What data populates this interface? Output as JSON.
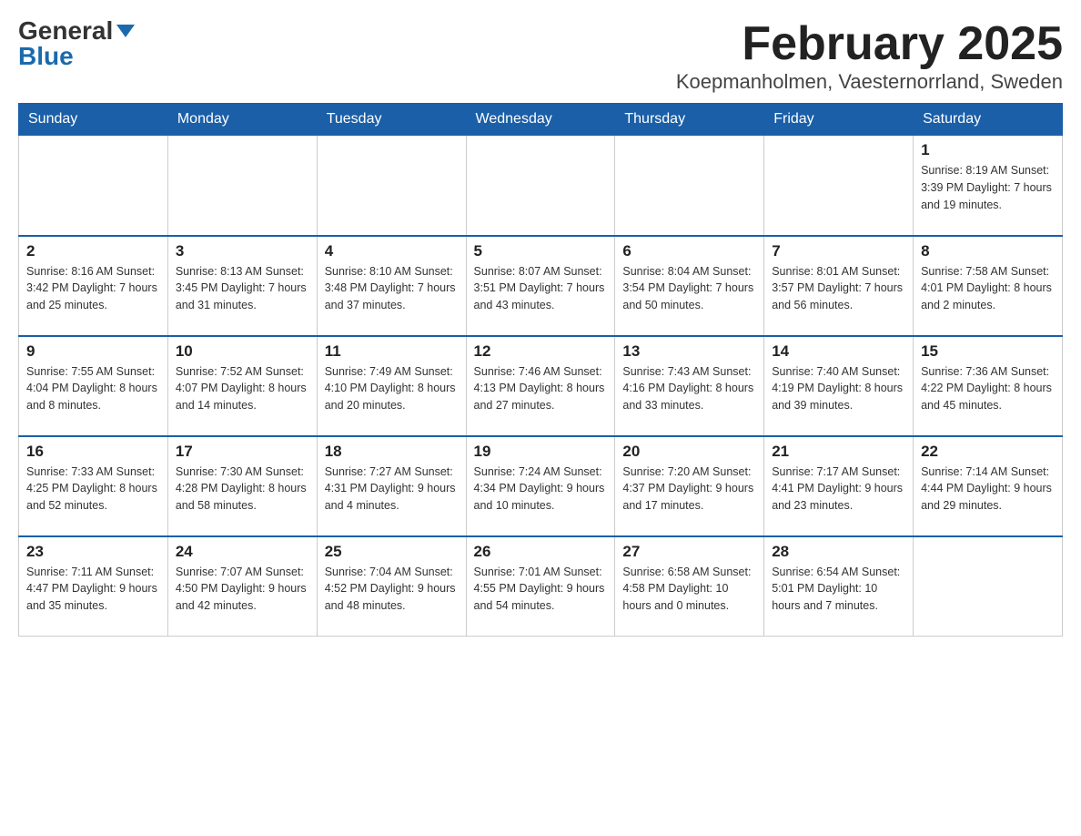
{
  "header": {
    "logo_general": "General",
    "logo_blue": "Blue",
    "month_year": "February 2025",
    "location": "Koepmanholmen, Vaesternorrland, Sweden"
  },
  "days_of_week": [
    "Sunday",
    "Monday",
    "Tuesday",
    "Wednesday",
    "Thursday",
    "Friday",
    "Saturday"
  ],
  "weeks": [
    {
      "days": [
        {
          "number": "",
          "info": ""
        },
        {
          "number": "",
          "info": ""
        },
        {
          "number": "",
          "info": ""
        },
        {
          "number": "",
          "info": ""
        },
        {
          "number": "",
          "info": ""
        },
        {
          "number": "",
          "info": ""
        },
        {
          "number": "1",
          "info": "Sunrise: 8:19 AM\nSunset: 3:39 PM\nDaylight: 7 hours and 19 minutes."
        }
      ]
    },
    {
      "days": [
        {
          "number": "2",
          "info": "Sunrise: 8:16 AM\nSunset: 3:42 PM\nDaylight: 7 hours and 25 minutes."
        },
        {
          "number": "3",
          "info": "Sunrise: 8:13 AM\nSunset: 3:45 PM\nDaylight: 7 hours and 31 minutes."
        },
        {
          "number": "4",
          "info": "Sunrise: 8:10 AM\nSunset: 3:48 PM\nDaylight: 7 hours and 37 minutes."
        },
        {
          "number": "5",
          "info": "Sunrise: 8:07 AM\nSunset: 3:51 PM\nDaylight: 7 hours and 43 minutes."
        },
        {
          "number": "6",
          "info": "Sunrise: 8:04 AM\nSunset: 3:54 PM\nDaylight: 7 hours and 50 minutes."
        },
        {
          "number": "7",
          "info": "Sunrise: 8:01 AM\nSunset: 3:57 PM\nDaylight: 7 hours and 56 minutes."
        },
        {
          "number": "8",
          "info": "Sunrise: 7:58 AM\nSunset: 4:01 PM\nDaylight: 8 hours and 2 minutes."
        }
      ]
    },
    {
      "days": [
        {
          "number": "9",
          "info": "Sunrise: 7:55 AM\nSunset: 4:04 PM\nDaylight: 8 hours and 8 minutes."
        },
        {
          "number": "10",
          "info": "Sunrise: 7:52 AM\nSunset: 4:07 PM\nDaylight: 8 hours and 14 minutes."
        },
        {
          "number": "11",
          "info": "Sunrise: 7:49 AM\nSunset: 4:10 PM\nDaylight: 8 hours and 20 minutes."
        },
        {
          "number": "12",
          "info": "Sunrise: 7:46 AM\nSunset: 4:13 PM\nDaylight: 8 hours and 27 minutes."
        },
        {
          "number": "13",
          "info": "Sunrise: 7:43 AM\nSunset: 4:16 PM\nDaylight: 8 hours and 33 minutes."
        },
        {
          "number": "14",
          "info": "Sunrise: 7:40 AM\nSunset: 4:19 PM\nDaylight: 8 hours and 39 minutes."
        },
        {
          "number": "15",
          "info": "Sunrise: 7:36 AM\nSunset: 4:22 PM\nDaylight: 8 hours and 45 minutes."
        }
      ]
    },
    {
      "days": [
        {
          "number": "16",
          "info": "Sunrise: 7:33 AM\nSunset: 4:25 PM\nDaylight: 8 hours and 52 minutes."
        },
        {
          "number": "17",
          "info": "Sunrise: 7:30 AM\nSunset: 4:28 PM\nDaylight: 8 hours and 58 minutes."
        },
        {
          "number": "18",
          "info": "Sunrise: 7:27 AM\nSunset: 4:31 PM\nDaylight: 9 hours and 4 minutes."
        },
        {
          "number": "19",
          "info": "Sunrise: 7:24 AM\nSunset: 4:34 PM\nDaylight: 9 hours and 10 minutes."
        },
        {
          "number": "20",
          "info": "Sunrise: 7:20 AM\nSunset: 4:37 PM\nDaylight: 9 hours and 17 minutes."
        },
        {
          "number": "21",
          "info": "Sunrise: 7:17 AM\nSunset: 4:41 PM\nDaylight: 9 hours and 23 minutes."
        },
        {
          "number": "22",
          "info": "Sunrise: 7:14 AM\nSunset: 4:44 PM\nDaylight: 9 hours and 29 minutes."
        }
      ]
    },
    {
      "days": [
        {
          "number": "23",
          "info": "Sunrise: 7:11 AM\nSunset: 4:47 PM\nDaylight: 9 hours and 35 minutes."
        },
        {
          "number": "24",
          "info": "Sunrise: 7:07 AM\nSunset: 4:50 PM\nDaylight: 9 hours and 42 minutes."
        },
        {
          "number": "25",
          "info": "Sunrise: 7:04 AM\nSunset: 4:52 PM\nDaylight: 9 hours and 48 minutes."
        },
        {
          "number": "26",
          "info": "Sunrise: 7:01 AM\nSunset: 4:55 PM\nDaylight: 9 hours and 54 minutes."
        },
        {
          "number": "27",
          "info": "Sunrise: 6:58 AM\nSunset: 4:58 PM\nDaylight: 10 hours and 0 minutes."
        },
        {
          "number": "28",
          "info": "Sunrise: 6:54 AM\nSunset: 5:01 PM\nDaylight: 10 hours and 7 minutes."
        },
        {
          "number": "",
          "info": ""
        }
      ]
    }
  ]
}
